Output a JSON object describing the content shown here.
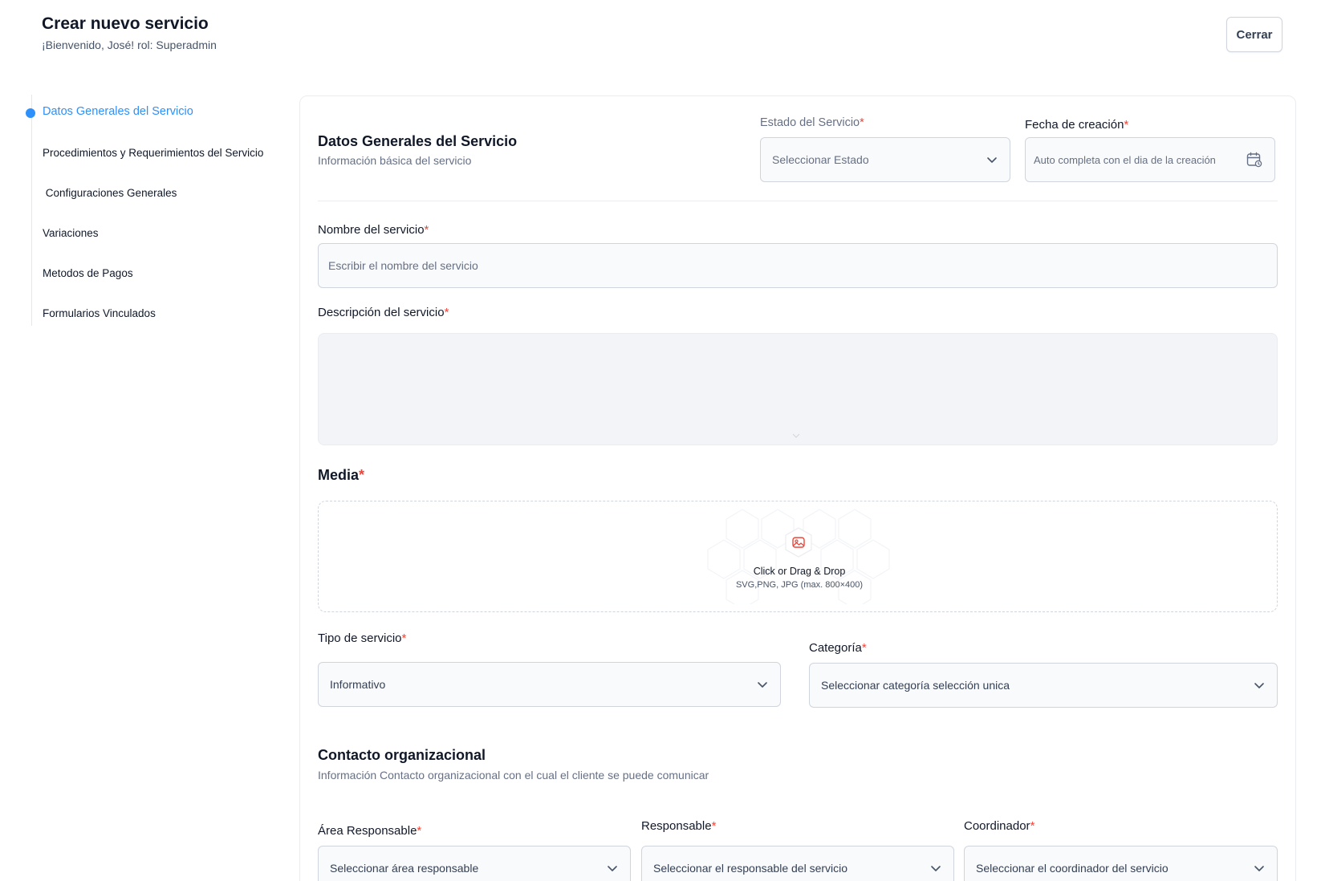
{
  "header": {
    "title": "Crear nuevo servicio",
    "subtitle": "¡Bienvenido, José! rol: Superadmin",
    "close_label": "Cerrar"
  },
  "stepper": {
    "items": [
      {
        "label": "Datos Generales del Servicio",
        "active": true
      },
      {
        "label": "Procedimientos y Requerimientos del Servicio",
        "active": false
      },
      {
        "label": " Configuraciones Generales",
        "active": false
      },
      {
        "label": "Variaciones",
        "active": false
      },
      {
        "label": "Metodos de Pagos",
        "active": false
      },
      {
        "label": "Formularios Vinculados",
        "active": false
      }
    ]
  },
  "general": {
    "title": "Datos Generales del Servicio",
    "subtitle": "Información básica del servicio",
    "estado_label": "Estado del Servicio",
    "estado_placeholder": "Seleccionar Estado",
    "fecha_label": "Fecha de creación",
    "fecha_placeholder": "Auto completa con el dia de la creación",
    "nombre_label": "Nombre del servicio",
    "nombre_placeholder": "Escribir el nombre del servicio",
    "descripcion_label": "Descripción del servicio"
  },
  "media": {
    "label": "Media",
    "dropzone_title": "Click or Drag & Drop",
    "dropzone_hint": "SVG,PNG, JPG (max. 800×400)"
  },
  "tipo": {
    "label": "Tipo de servicio",
    "value": "Informativo"
  },
  "categoria": {
    "label": "Categoría",
    "placeholder": "Seleccionar categoría selección unica"
  },
  "contacto": {
    "title": "Contacto organizacional",
    "subtitle": "Información Contacto organizacional con el cual el cliente se puede comunicar",
    "area_label": "Área Responsable",
    "area_placeholder": "Seleccionar área responsable",
    "responsable_label": "Responsable",
    "responsable_placeholder": "Seleccionar el responsable del servicio",
    "coordinador_label": "Coordinador",
    "coordinador_placeholder": "Seleccionar el coordinador del servicio"
  },
  "required_mark": "*",
  "icons": [
    "chevron-down-icon",
    "calendar-icon",
    "image-upload-icon"
  ],
  "colors": {
    "accent": "#2e90fa",
    "required": "#f04438",
    "upload_icon": "#f04438"
  }
}
